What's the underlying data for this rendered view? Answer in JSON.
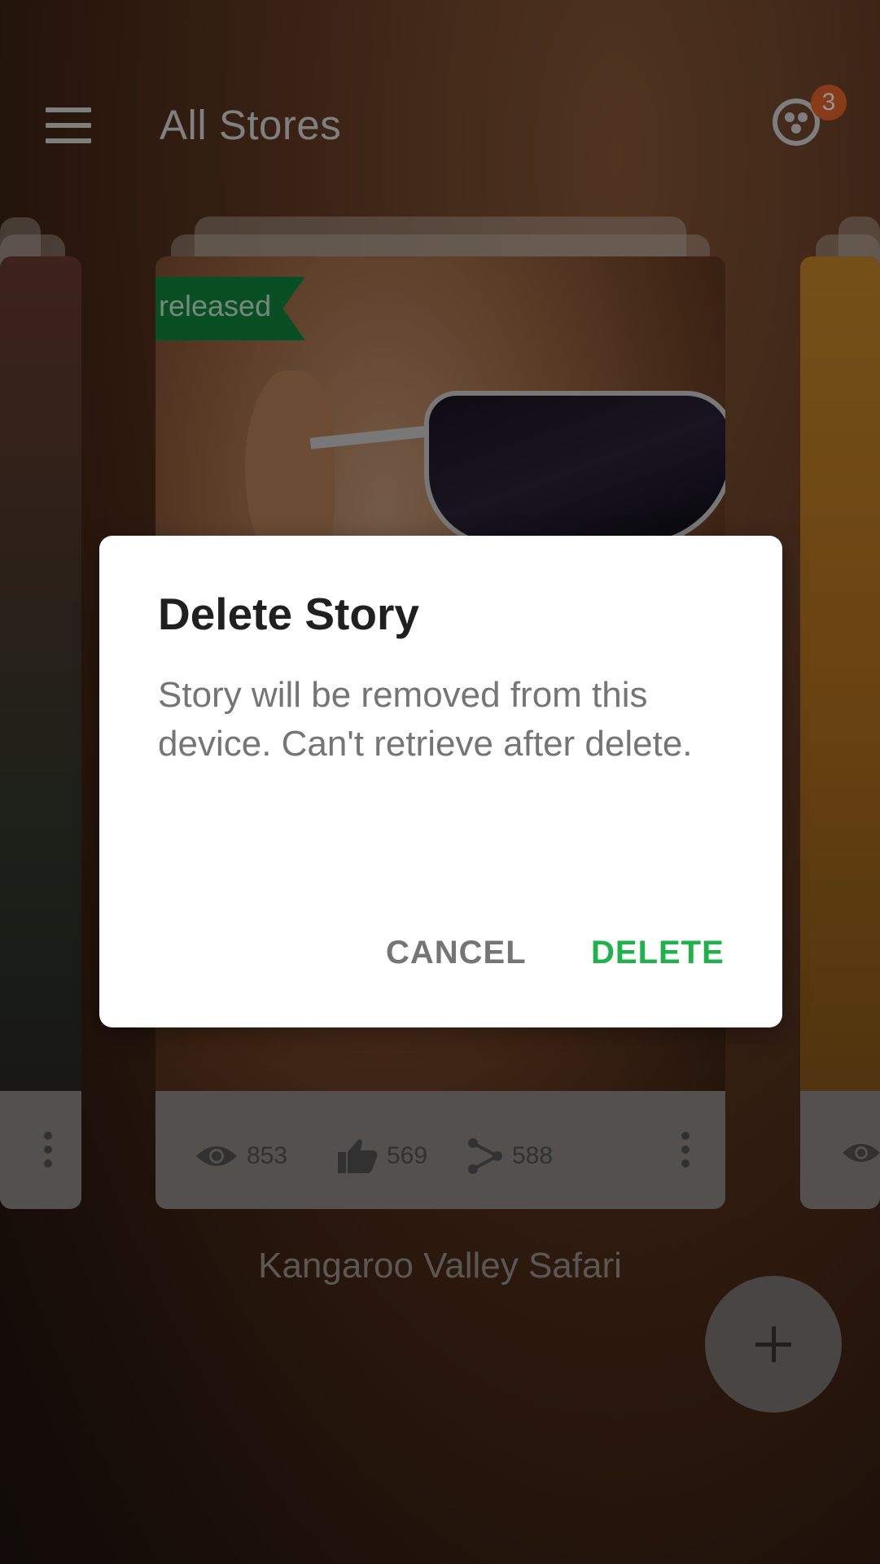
{
  "header": {
    "title": "All Stores",
    "notification_count": "3"
  },
  "card": {
    "status_flag": "released",
    "views": "853",
    "likes": "569",
    "shares": "588",
    "story_title": "Kangaroo Valley Safari"
  },
  "dialog": {
    "title": "Delete Story",
    "message": "Story will be removed from this device. Can't retrieve after delete.",
    "cancel_label": "CANCEL",
    "delete_label": "DELETE"
  },
  "colors": {
    "badge": "#e9662a",
    "flag": "#0f8a3f",
    "delete_accent": "#1fb24a"
  },
  "icons": [
    "menu-icon",
    "group-icon",
    "eye-icon",
    "thumbs-up-icon",
    "share-icon",
    "more-vert-icon",
    "plus-icon"
  ]
}
